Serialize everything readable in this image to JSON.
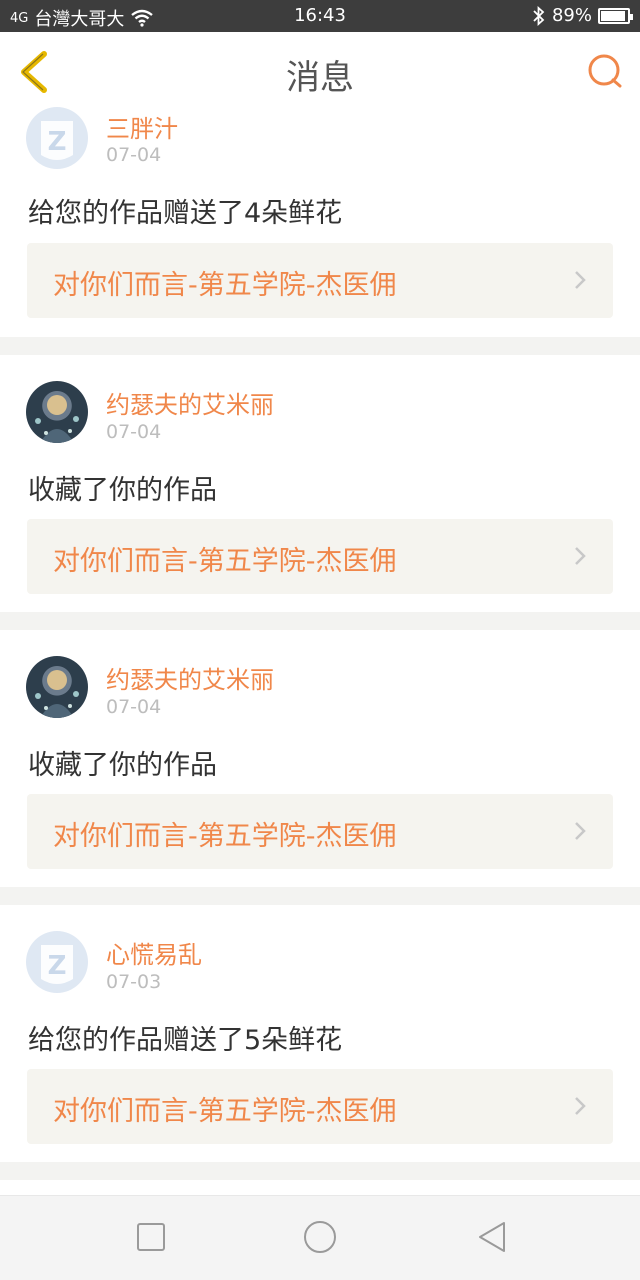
{
  "status_bar": {
    "signal": "4G",
    "carrier": "台灣大哥大",
    "time": "16:43",
    "battery": "89%"
  },
  "header": {
    "title": "消息"
  },
  "messages": [
    {
      "name": "三胖汁",
      "date": "07-04",
      "text": "给您的作品赠送了4朵鲜花",
      "work_title": "对你们而言-第五学院-杰医佣",
      "avatar": "default-avatar"
    },
    {
      "name": "约瑟夫的艾米丽",
      "date": "07-04",
      "text": "收藏了你的作品",
      "work_title": "对你们而言-第五学院-杰医佣",
      "avatar": "photo-avatar"
    },
    {
      "name": "约瑟夫的艾米丽",
      "date": "07-04",
      "text": "收藏了你的作品",
      "work_title": "对你们而言-第五学院-杰医佣",
      "avatar": "photo-avatar"
    },
    {
      "name": "心慌易乱",
      "date": "07-03",
      "text": "给您的作品赠送了5朵鲜花",
      "work_title": "对你们而言-第五学院-杰医佣",
      "avatar": "default-avatar"
    }
  ],
  "colors": {
    "accent": "#f0874a",
    "back_icon": "#e6b800"
  },
  "icons": {
    "back": "chevron-left-icon",
    "search": "search-icon",
    "nav_recent": "square-icon",
    "nav_home": "circle-icon",
    "nav_back": "triangle-back-icon"
  }
}
